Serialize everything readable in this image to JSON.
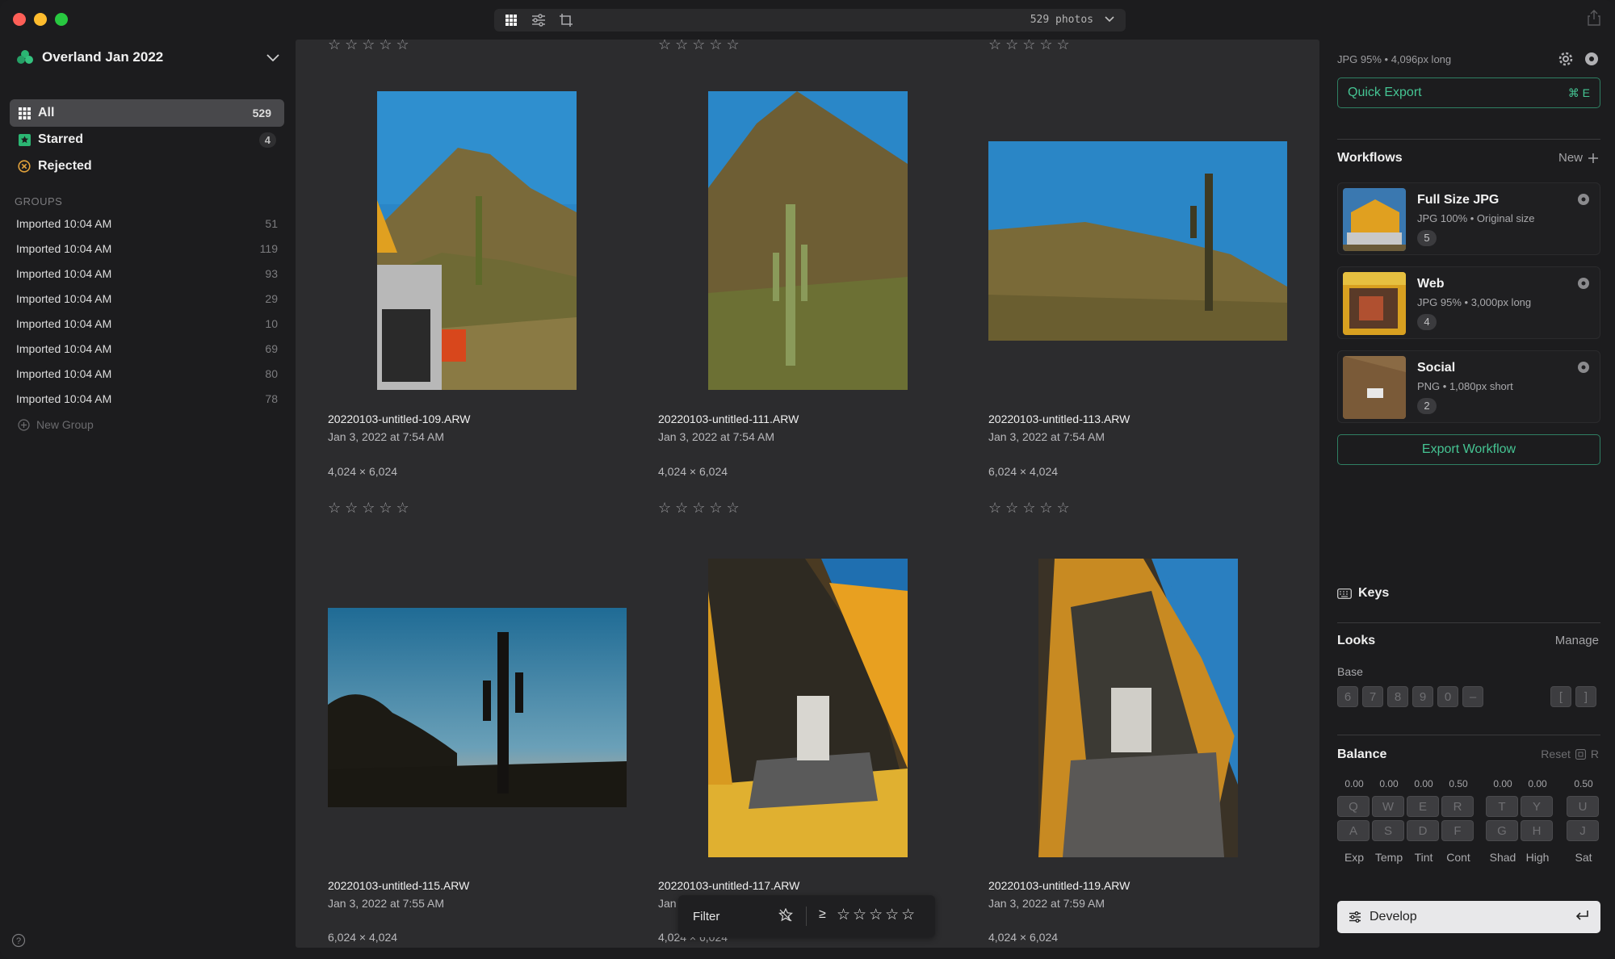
{
  "toolbar": {
    "photo_count": "529 photos"
  },
  "sidebar": {
    "library": "Overland Jan 2022",
    "nav": [
      {
        "label": "All",
        "count": "529"
      },
      {
        "label": "Starred",
        "count": "4"
      },
      {
        "label": "Rejected",
        "count": ""
      }
    ],
    "groups_header": "GROUPS",
    "groups": [
      {
        "label": "Imported 10:04 AM",
        "count": "51"
      },
      {
        "label": "Imported 10:04 AM",
        "count": "119"
      },
      {
        "label": "Imported 10:04 AM",
        "count": "93"
      },
      {
        "label": "Imported 10:04 AM",
        "count": "29"
      },
      {
        "label": "Imported 10:04 AM",
        "count": "10"
      },
      {
        "label": "Imported 10:04 AM",
        "count": "69"
      },
      {
        "label": "Imported 10:04 AM",
        "count": "80"
      },
      {
        "label": "Imported 10:04 AM",
        "count": "78"
      }
    ],
    "new_group": "New Group"
  },
  "grid": {
    "stars": "☆ ☆ ☆ ☆ ☆",
    "photos": [
      {
        "name": "20220103-untitled-109.ARW",
        "date": "Jan 3, 2022 at 7:54 AM",
        "dims": "4,024 × 6,024"
      },
      {
        "name": "20220103-untitled-111.ARW",
        "date": "Jan 3, 2022 at 7:54 AM",
        "dims": "4,024 × 6,024"
      },
      {
        "name": "20220103-untitled-113.ARW",
        "date": "Jan 3, 2022 at 7:54 AM",
        "dims": "6,024 × 4,024"
      },
      {
        "name": "20220103-untitled-115.ARW",
        "date": "Jan 3, 2022 at 7:55 AM",
        "dims": "6,024 × 4,024"
      },
      {
        "name": "20220103-untitled-117.ARW",
        "date": "Jan",
        "dims": "4,024 × 6,024"
      },
      {
        "name": "20220103-untitled-119.ARW",
        "date": "Jan 3, 2022 at 7:59 AM",
        "dims": "4,024 × 6,024"
      }
    ],
    "filter": {
      "label": "Filter",
      "op": "≥",
      "stars": "☆☆☆☆☆"
    }
  },
  "right": {
    "export_info": "JPG 95% • 4,096px long",
    "quick_export": "Quick Export",
    "quick_export_key": "⌘ E",
    "workflows_title": "Workflows",
    "workflows_new": "New",
    "workflows": [
      {
        "title": "Full Size JPG",
        "sub": "JPG 100% • Original size",
        "count": "5"
      },
      {
        "title": "Web",
        "sub": "JPG 95% • 3,000px long",
        "count": "4"
      },
      {
        "title": "Social",
        "sub": "PNG • 1,080px short",
        "count": "2"
      }
    ],
    "export_workflow": "Export Workflow",
    "keys": "Keys",
    "looks": "Looks",
    "manage": "Manage",
    "base": "Base",
    "base_keys": [
      "6",
      "7",
      "8",
      "9",
      "0",
      "–"
    ],
    "bracket_keys": [
      "[",
      "]"
    ],
    "balance": "Balance",
    "reset": "Reset",
    "reset_key": "R",
    "balance_values": [
      "0.00",
      "0.00",
      "0.00",
      "0.50",
      "0.00",
      "0.00",
      "0.50"
    ],
    "balance_top_keys": [
      "Q",
      "W",
      "E",
      "R",
      "T",
      "Y",
      "U"
    ],
    "balance_bottom_keys": [
      "A",
      "S",
      "D",
      "F",
      "G",
      "H",
      "J"
    ],
    "balance_labels": [
      "Exp",
      "Temp",
      "Tint",
      "Cont",
      "Shad",
      "High",
      "Sat"
    ],
    "develop": "Develop"
  }
}
